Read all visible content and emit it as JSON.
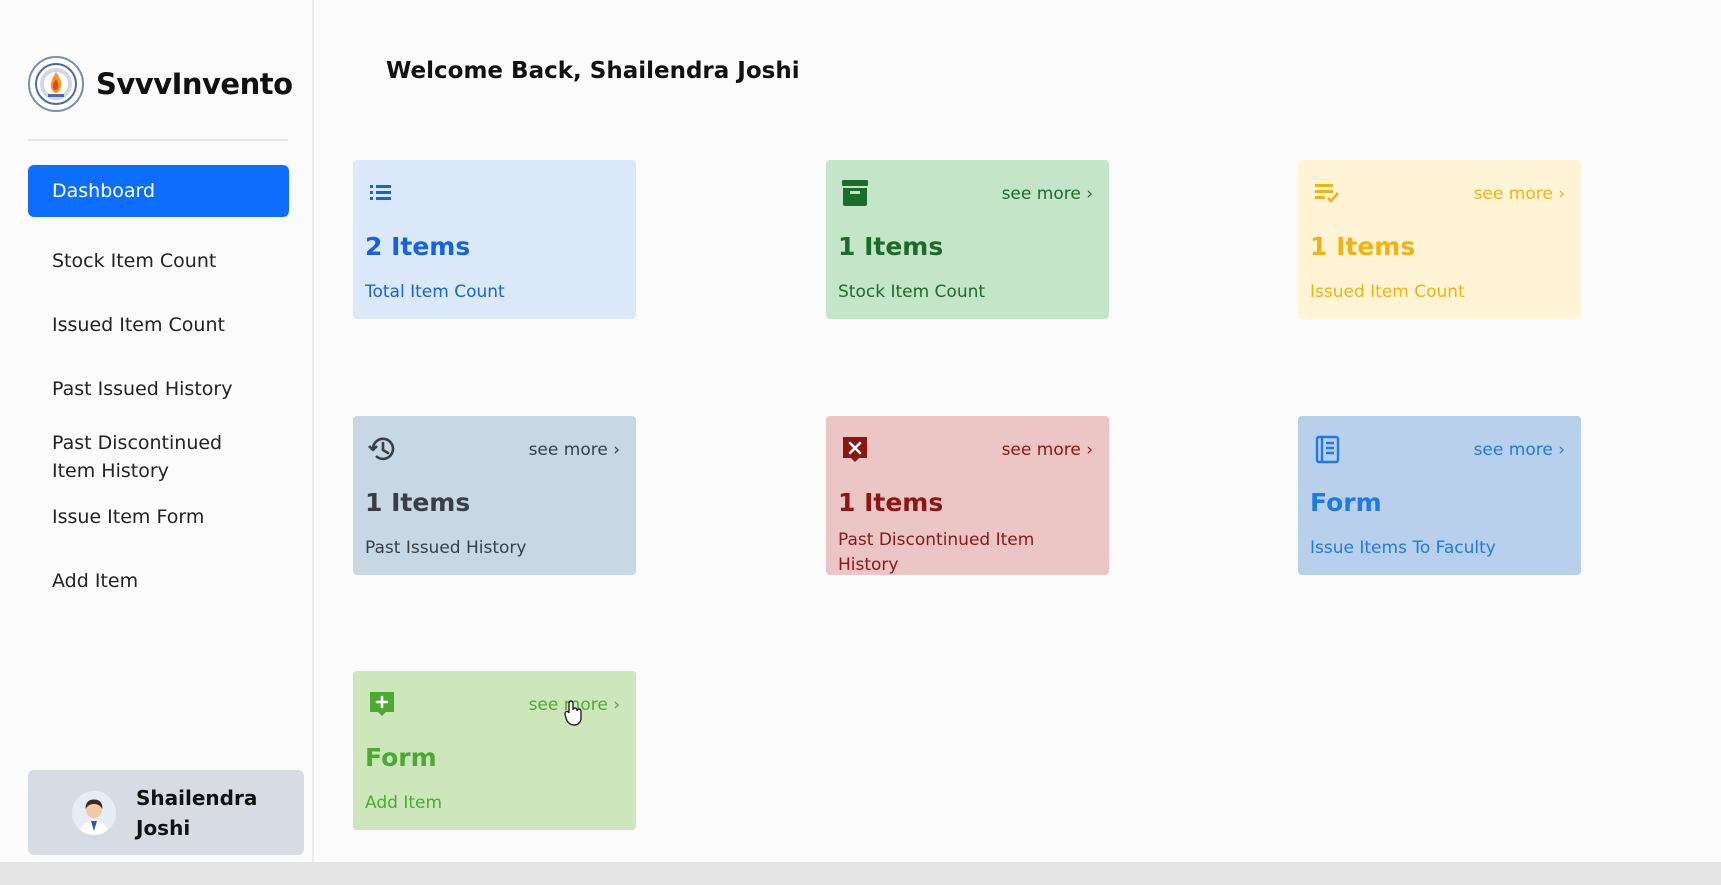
{
  "brand": {
    "name": "SvvvInvento",
    "logo_icon": "university-seal-logo"
  },
  "sidebar": {
    "items": [
      {
        "label": "Dashboard",
        "active": true
      },
      {
        "label": "Stock Item Count",
        "active": false
      },
      {
        "label": "Issued Item Count",
        "active": false
      },
      {
        "label": "Past Issued History",
        "active": false
      },
      {
        "label": "Past Discontinued Item History",
        "active": false
      },
      {
        "label": "Issue Item Form",
        "active": false
      },
      {
        "label": "Add Item",
        "active": false
      }
    ],
    "active_color": "#0d6efd"
  },
  "user": {
    "name": "Shailendra Joshi",
    "avatar_icon": "user-avatar-icon"
  },
  "header": {
    "welcome": "Welcome Back, Shailendra Joshi"
  },
  "cards": [
    {
      "icon": "list-icon",
      "count": "2 Items",
      "label": "Total Item Count",
      "see_more": "",
      "bg": "#dce9fb",
      "fg": "#1463e0"
    },
    {
      "icon": "archive-box-icon",
      "count": "1 Items",
      "label": "Stock Item Count",
      "see_more": "see more ›",
      "bg": "#c5e5c8",
      "fg": "#1b6b2a"
    },
    {
      "icon": "checklist-icon",
      "count": "1 Items",
      "label": "Issued Item Count",
      "see_more": "see more ›",
      "bg": "#fff4d6",
      "fg": "#f0b313"
    },
    {
      "icon": "history-icon",
      "count": "1 Items",
      "label": "Past Issued History",
      "see_more": "see more ›",
      "bg": "#c7d7e3",
      "fg": "#383e44"
    },
    {
      "icon": "discontinued-x-icon",
      "count": "1 Items",
      "label": "Past Discontinued Item History",
      "see_more": "see more ›",
      "bg": "#ebc6c5",
      "fg": "#8f1514"
    },
    {
      "icon": "notebook-icon",
      "count": "Form",
      "label": "Issue Items To Faculty",
      "see_more": "see more ›",
      "bg": "#b9d0ec",
      "fg": "#1f7ae8"
    },
    {
      "icon": "add-comment-icon",
      "count": "Form",
      "label": "Add Item",
      "see_more": "see more ›",
      "bg": "#cde6bc",
      "fg": "#4caa31"
    }
  ]
}
